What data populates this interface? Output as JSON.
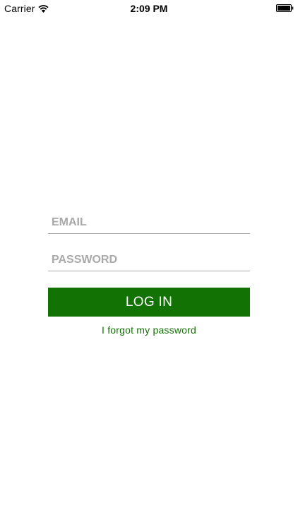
{
  "status_bar": {
    "carrier": "Carrier",
    "time": "2:09 PM",
    "icons": [
      "wifi-icon",
      "battery-icon"
    ]
  },
  "login": {
    "email_placeholder": "EMAIL",
    "email_value": "",
    "password_placeholder": "PASSWORD",
    "password_value": "",
    "login_label": "LOG IN",
    "forgot_label": "I forgot my password"
  },
  "colors": {
    "accent": "#127204",
    "placeholder": "#a9a9a9",
    "underline": "#a9a9a9",
    "background": "#ffffff"
  }
}
